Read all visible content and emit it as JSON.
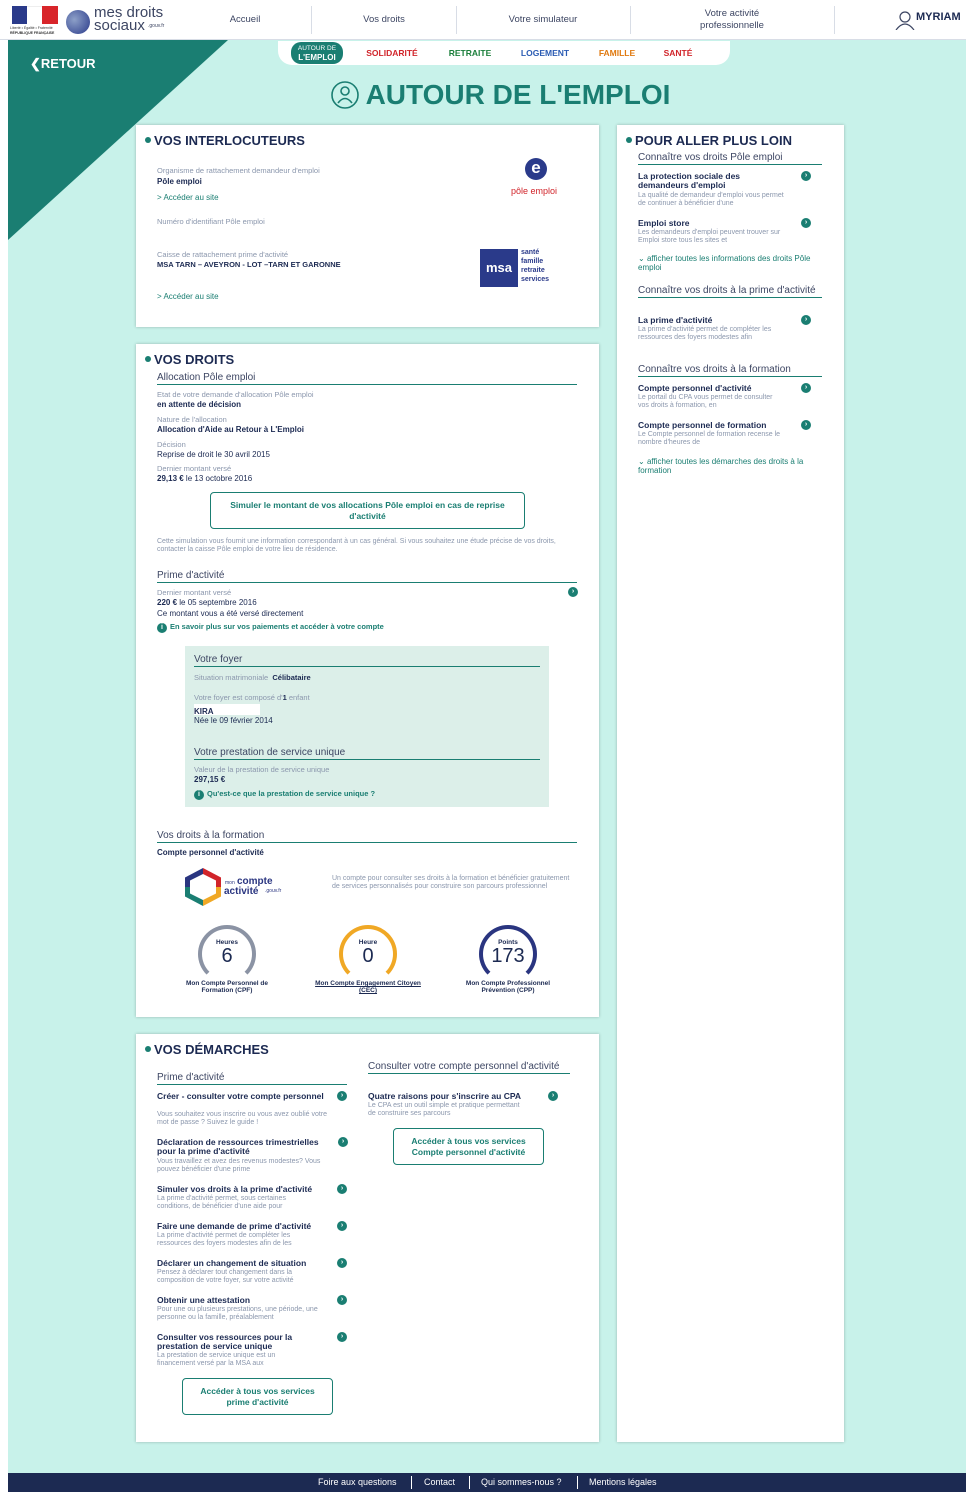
{
  "header": {
    "brand_line1": "mes droits",
    "brand_line2": "sociaux",
    "brand_suffix": ".gouv.fr",
    "flag_caption": "Liberté • Égalité • Fraternité",
    "flag_caption2": "RÉPUBLIQUE FRANÇAISE",
    "nav": [
      "Accueil",
      "Vos droits",
      "Votre simulateur",
      "Votre activité professionnelle"
    ],
    "user": "MYRIAM"
  },
  "subnav": {
    "active_line1": "AUTOUR DE",
    "active_line2": "L'EMPLOI",
    "items": [
      {
        "label": "SOLIDARITÉ",
        "color": "#d1242a"
      },
      {
        "label": "RETRAITE",
        "color": "#1a7e3a"
      },
      {
        "label": "LOGEMENT",
        "color": "#2a5bb3"
      },
      {
        "label": "FAMILLE",
        "color": "#e07a10"
      },
      {
        "label": "SANTÉ",
        "color": "#d1242a"
      }
    ]
  },
  "back": "RETOUR",
  "page_title": "AUTOUR DE L'EMPLOI",
  "interlocuteurs": {
    "title": "VOS INTERLOCUTEURS",
    "org_label": "Organisme de rattachement demandeur d'emploi",
    "org_value": "Pôle emploi",
    "org_link": "> Accéder au site",
    "id_label": "Numéro d'identifiant Pôle emploi",
    "caisse_label": "Caisse de rattachement prime d'activité",
    "caisse_value": "MSA TARN – AVEYRON - LOT –TARN ET GARONNE",
    "caisse_link": "> Accéder au site",
    "pe_logo_text": "pôle emploi",
    "msa_words": [
      "santé",
      "famille",
      "retraite",
      "services"
    ]
  },
  "droits": {
    "title": "VOS DROITS",
    "alloc_title": "Allocation Pôle emploi",
    "etat_label": "Etat de votre demande d'allocation Pôle emploi",
    "etat_value": "en attente de décision",
    "nature_label": "Nature de l'allocation",
    "nature_value": "Allocation d'Aide au Retour à L'Emploi",
    "decision_label": "Décision",
    "decision_value": "Reprise de droit le 30 avril 2015",
    "montant_label": "Dernier montant versé",
    "montant_amount": "29,13 €",
    "montant_date": " le 13 octobre 2016",
    "simul_button": "Simuler le montant de vos allocations Pôle emploi en cas de reprise d'activité",
    "simul_note": "Cette simulation vous fournit une information correspondant à un cas général. Si vous souhaitez une étude précise de vos droits, contacter la caisse Pôle emploi de votre lieu de résidence.",
    "prime_title": "Prime d'activité",
    "prime_label": "Dernier montant versé",
    "prime_amount": "220 €",
    "prime_date": " le 05 septembre 2016",
    "prime_note": "Ce montant vous a été versé directement",
    "prime_info_link": "En savoir plus sur vos paiements et accéder à votre compte",
    "foyer_title": "Votre foyer",
    "situation_label": "Situation matrimoniale",
    "situation_value": "Célibataire",
    "foyer_compo_a": "Votre foyer est composé d'",
    "foyer_compo_n": "1",
    "foyer_compo_b": " enfant",
    "child_name": "KIRA",
    "child_birth": "Née le 09 février 2014",
    "psu_title": "Votre prestation de service unique",
    "psu_label": "Valeur de la prestation de service unique",
    "psu_value": "297,15 €",
    "psu_link": "Qu'est-ce que la prestation de service unique ?",
    "formation_title": "Vos droits à la formation",
    "cpa_title": "Compte personnel d'activité",
    "cpa_logo_small": "mon",
    "cpa_logo_big1": "compte",
    "cpa_logo_big2": "activité",
    "cpa_logo_suffix": ".gouv.fr",
    "cpa_text": "Un compte pour consulter ses droits à la formation et bénéficier gratuitement de services personnalisés pour construire son parcours professionnel",
    "gauges": [
      {
        "label": "Heures",
        "value": "6",
        "caption": "Mon Compte Personnel de Formation (CPF)",
        "color": "#8b93a4",
        "link": false
      },
      {
        "label": "Heure",
        "value": "0",
        "caption": "Mon Compte Engagement Citoyen (CEC)",
        "color": "#f0a825",
        "link": true
      },
      {
        "label": "Points",
        "value": "173",
        "caption": "Mon Compte Professionnel Prévention (CPP)",
        "color": "#2a3580",
        "link": false
      }
    ]
  },
  "demarches": {
    "title": "VOS DÉMARCHES",
    "col1_title": "Prime d'activité",
    "col2_title": "Consulter votre compte personnel d'activité",
    "items": [
      {
        "title": "Créer - consulter votre compte personnel",
        "desc": "Vous souhaitez vous inscrire ou vous avez oublié votre mot de passe ? Suivez le guide !"
      },
      {
        "title": "Déclaration de ressources trimestrielles pour la prime d'activité",
        "desc": "Vous travaillez et avez des revenus modestes? Vous pouvez bénéficier d'une prime"
      },
      {
        "title": "Simuler vos droits à la prime d'activité",
        "desc": "La prime d'activité permet, sous certaines conditions, de bénéficier d'une aide pour"
      },
      {
        "title": "Faire une demande de prime d'activité",
        "desc": "La prime d'activité permet de compléter les ressources des foyers modestes afin de les"
      },
      {
        "title": "Déclarer un changement de situation",
        "desc": "Pensez à déclarer tout changement dans la composition de votre foyer, sur votre activité"
      },
      {
        "title": "Obtenir une attestation",
        "desc": "Pour une ou plusieurs prestations, une période, une personne ou la famille, préalablement"
      },
      {
        "title": "Consulter vos ressources pour la prestation de service unique",
        "desc": "La prestation de service unique est un financement versé par la MSA aux"
      }
    ],
    "col1_button": "Accéder à tous vos services prime d'activité",
    "cpa_item_title": "Quatre raisons pour s'inscrire au CPA",
    "cpa_item_desc": "Le CPA est un outil simple et pratique permettant de construire ses parcours",
    "col2_button": "Accéder à tous vos services Compte personnel d'activité"
  },
  "loin": {
    "title": "POUR ALLER PLUS LOIN",
    "sec1_title": "Connaître vos droits Pôle emploi",
    "sec1_items": [
      {
        "title": "La protection sociale des demandeurs d'emploi",
        "desc": "La qualité de demandeur d'emploi vous permet de continuer à bénéficier d'une"
      },
      {
        "title": "Emploi store",
        "desc": "Les demandeurs d'emploi peuvent trouver sur Emploi store tous les sites et"
      }
    ],
    "sec1_more": "afficher toutes les informations des droits Pôle emploi",
    "sec2_title": "Connaître vos droits à la prime d'activité",
    "sec2_items": [
      {
        "title": "La prime d'activité",
        "desc": "La prime d'activité permet de compléter les ressources des foyers modestes afin"
      }
    ],
    "sec3_title": "Connaître vos droits à la formation",
    "sec3_items": [
      {
        "title": "Compte personnel d'activité",
        "desc": "Le portail du CPA vous permet de consulter vos droits à formation, en"
      },
      {
        "title": "Compte personnel de formation",
        "desc": "Le Compte personnel de formation recense le nombre d'heures de"
      }
    ],
    "sec3_more": "afficher toutes les démarches des droits à la formation"
  },
  "footer": [
    "Foire aux questions",
    "Contact",
    "Qui sommes-nous ?",
    "Mentions légales"
  ]
}
